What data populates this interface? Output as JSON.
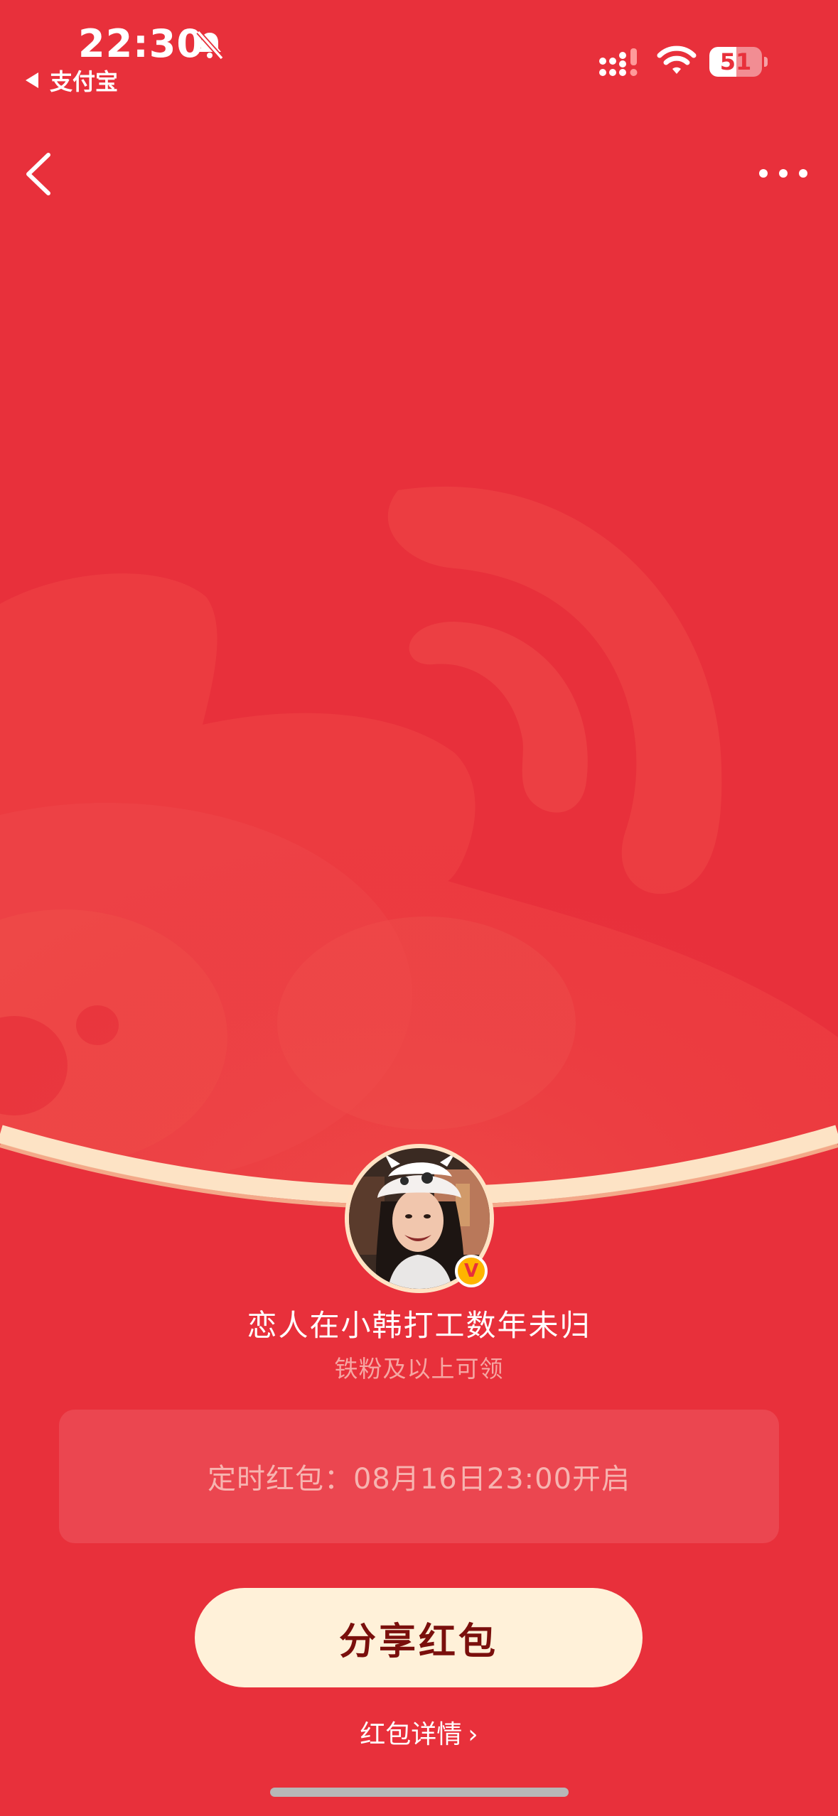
{
  "status_bar": {
    "time": "22:30",
    "back_app_label": "支付宝",
    "battery_level": "51",
    "battery_fraction": 0.51,
    "icons": [
      "bell-slash-icon",
      "signal-icon",
      "wifi-icon",
      "battery-icon"
    ]
  },
  "nav": {
    "back_icon": "chevron-left-icon",
    "more_icon": "more-dots-icon"
  },
  "profile": {
    "name": "恋人在小韩打工数年未归",
    "condition": "铁粉及以上可领",
    "verified_badge": "V"
  },
  "red_packet": {
    "timer_text": "定时红包：08月16日23:00开启",
    "share_button_label": "分享红包",
    "details_link_label": "红包详情",
    "details_chevron": "›"
  },
  "colors": {
    "background": "#e8303b",
    "button_bg": "#fff1d9",
    "button_text": "#7a0f0c",
    "arc": "#fde3c5"
  }
}
